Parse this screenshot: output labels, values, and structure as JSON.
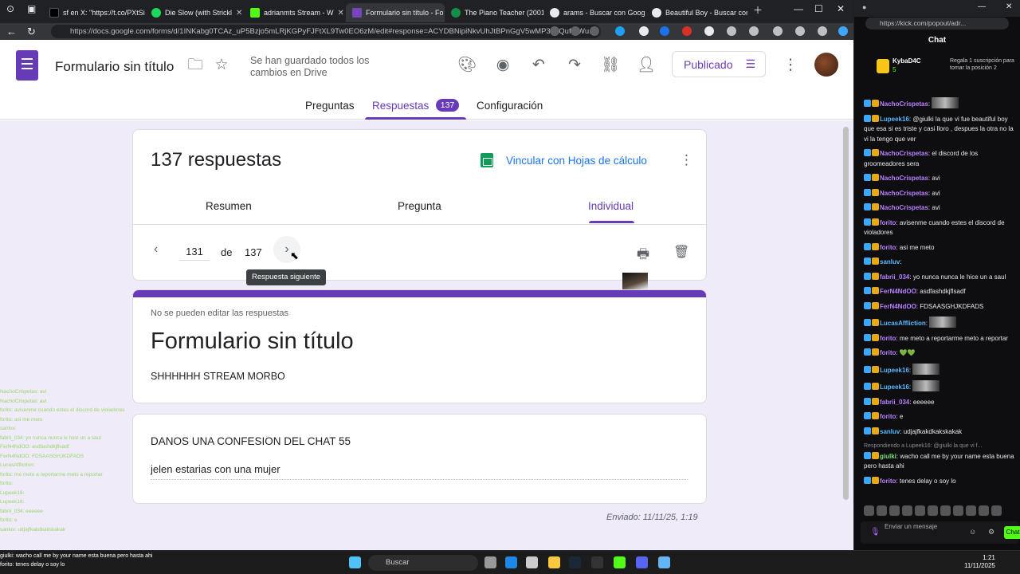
{
  "browser": {
    "tabs": [
      {
        "label": "sf en X: \"https://t.co/PXtSi",
        "color": "#000000"
      },
      {
        "label": "Die Slow (with Strickl",
        "color": "#1ed760"
      },
      {
        "label": "adrianmts Stream - W",
        "color": "#53fc18"
      },
      {
        "label": "Formulario sin título - Fo",
        "color": "#7248b9"
      },
      {
        "label": "The Piano Teacher (2001)",
        "color": "#138f45"
      },
      {
        "label": "arams - Buscar con Googl",
        "color": "#e8eaed"
      },
      {
        "label": "Beautiful Boy - Buscar con",
        "color": "#e8eaed"
      }
    ],
    "url": "https://docs.google.com/forms/d/1INKabg0TCAz_uP5Bzjo5mLRjKGPyFJFtXL9Tw0EO6zM/edit#response=ACYDBNipiNkvUhJtBPnGgV5wMP3ahQuf-uWu..."
  },
  "header": {
    "doc_title": "Formulario sin título",
    "save_status": "Se han guardado todos los cambios en Drive",
    "publish_label": "Publicado",
    "tabs": {
      "preguntas": "Preguntas",
      "respuestas": "Respuestas",
      "config": "Configuración"
    },
    "response_badge": "137"
  },
  "summary": {
    "title": "137 respuestas",
    "sheets_link": "Vincular con Hojas de cálculo",
    "subtabs": {
      "resumen": "Resumen",
      "pregunta": "Pregunta",
      "individual": "Individual"
    },
    "pager": {
      "current": "131",
      "de": "de",
      "total": "137",
      "tooltip": "Respuesta siguiente"
    }
  },
  "form": {
    "not_editable": "No se pueden editar las respuestas",
    "title": "Formulario sin título",
    "description": "SHHHHHH STREAM MORBO"
  },
  "question": {
    "text": "DANOS UNA CONFESION DEL CHAT 55",
    "answer": "jelen estarias con una mujer"
  },
  "submitted": "Enviado: 11/11/25, 1:19",
  "overlay_chat": [
    "NachoCrispetas: avi",
    "NachoCrispetas: avi",
    "forito: avisenme cuando estes el discord de violadores",
    "forito: asi me meto",
    "sanluv:",
    "fabrii_034: yo nunca nunca le hice un a saul",
    "FerN4NdOO: asdfashdkjflsadf",
    "FerN4NdOO: FDSAASGHJKDFADS",
    "LucasAffliction:",
    "forito: me meto a reportarme meto a reportar",
    "forito:",
    "Lupeek16:",
    "Lupeek16:",
    "fabrii_034: eeeeee",
    "forito: e",
    "sanluv: udjajfkakdkakskakak"
  ],
  "taskbar": {
    "search_placeholder": "Buscar",
    "time": "1:21",
    "date": "11/11/2025",
    "notification": "giulki: wacho call me by your name esta buena pero hasta ahi",
    "notification_sub": "forito: tenes delay o soy lo"
  },
  "chat": {
    "url": "https://kick.com/popout/adr...",
    "title": "Chat",
    "gift_user": "KybaD4C",
    "gift_count": "5",
    "gift_text": "Regala 1 suscripción para tomar la posición 2",
    "messages": [
      {
        "user": "NachoCrispetas",
        "text": "",
        "color": "purple",
        "thumb": true
      },
      {
        "user": "Lupeek16",
        "text": "@giulki la que vi fue beautiful boy que esa si es triste y casi lloro , despues la otra no la vi la tengo que ver",
        "color": "blue"
      },
      {
        "user": "NachoCrispetas",
        "text": "el discord de los groomeadores sera",
        "color": "purple"
      },
      {
        "user": "NachoCrispetas",
        "text": "avi",
        "color": "purple"
      },
      {
        "user": "NachoCrispetas",
        "text": "avi",
        "color": "purple"
      },
      {
        "user": "NachoCrispetas",
        "text": "avi",
        "color": "purple"
      },
      {
        "user": "forito",
        "text": "avisenme cuando estes el discord de violadores",
        "color": "purple"
      },
      {
        "user": "forito",
        "text": "asi me meto",
        "color": "purple"
      },
      {
        "user": "sanluv",
        "text": "",
        "color": "blue"
      },
      {
        "user": "fabrii_034",
        "text": "yo nunca nunca le hice un  a saul",
        "color": "purple"
      },
      {
        "user": "FerN4NdOO",
        "text": "asdfashdkjflsadf",
        "color": "purple"
      },
      {
        "user": "FerN4NdOO",
        "text": "FDSAASGHJKDFADS",
        "color": "purple"
      },
      {
        "user": "LucasAffliction",
        "text": "",
        "color": "blue",
        "thumb": true
      },
      {
        "user": "forito",
        "text": "me meto a reportarme meto a reportar",
        "color": "purple"
      },
      {
        "user": "forito",
        "text": "💚💚",
        "color": "purple"
      },
      {
        "user": "Lupeek16",
        "text": "",
        "color": "blue",
        "thumb": true
      },
      {
        "user": "Lupeek16",
        "text": "",
        "color": "blue",
        "thumb": true
      },
      {
        "user": "fabrii_034",
        "text": "eeeeee",
        "color": "purple"
      },
      {
        "user": "forito",
        "text": "e",
        "color": "purple"
      },
      {
        "user": "sanluv",
        "text": "udjajfkakdkakskakak",
        "color": "blue"
      },
      {
        "user": "giulki",
        "text": "wacho call me by your name esta buena pero hasta ahi",
        "color": "green",
        "reply": "Respondiendo a Lupeek16: @giulki la que vi f..."
      },
      {
        "user": "forito",
        "text": "tenes delay o soy lo",
        "color": "purple"
      }
    ],
    "input_placeholder": "Enviar un mensaje",
    "send_label": "Chat"
  }
}
